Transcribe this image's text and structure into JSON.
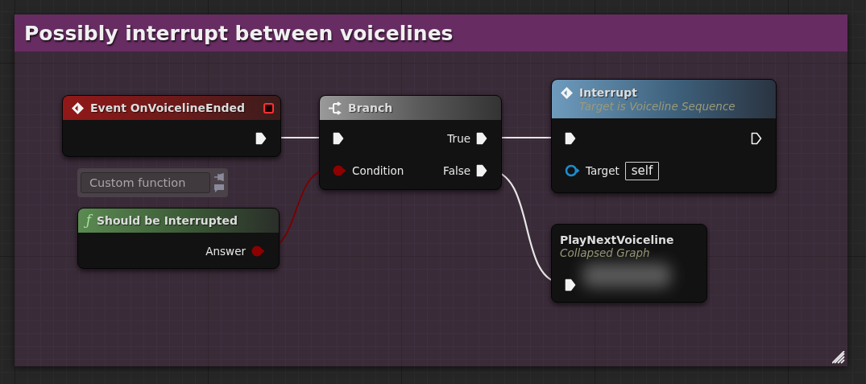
{
  "comment": {
    "title": "Possibly interrupt between voicelines"
  },
  "nodes": [
    {
      "kind": "event",
      "title": "Event OnVoicelineEnded",
      "outputs": [
        {
          "kind": "exec",
          "connected": true
        }
      ]
    },
    {
      "kind": "function",
      "glyph": "ƒ",
      "title": "Should be Interrupted",
      "comment": "Custom function",
      "outputs": [
        {
          "kind": "bool",
          "label": "Answer",
          "connected": true
        }
      ]
    },
    {
      "kind": "branch",
      "title": "Branch",
      "inputs": [
        {
          "kind": "exec",
          "connected": true
        },
        {
          "kind": "bool",
          "label": "Condition",
          "connected": true
        }
      ],
      "outputs": [
        {
          "kind": "exec",
          "label": "True",
          "connected": true
        },
        {
          "kind": "exec",
          "label": "False",
          "connected": true
        }
      ]
    },
    {
      "kind": "call",
      "title": "Interrupt",
      "subtitle": "Target is Voiceline Sequence",
      "inputs": [
        {
          "kind": "exec",
          "connected": true
        },
        {
          "kind": "object",
          "label": "Target",
          "connected": false,
          "value": "self"
        }
      ],
      "outputs": [
        {
          "kind": "exec",
          "connected": false
        }
      ]
    },
    {
      "kind": "collapsed",
      "title": "PlayNextVoiceline",
      "subtitle": "Collapsed Graph",
      "inputs": [
        {
          "kind": "exec",
          "connected": true
        }
      ]
    }
  ]
}
